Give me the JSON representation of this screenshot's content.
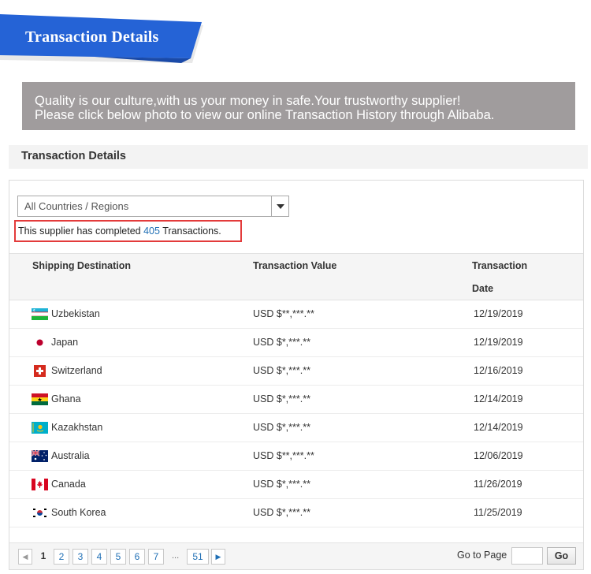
{
  "banner": {
    "title": "Transaction Details",
    "color": "#2563d6"
  },
  "notice": {
    "line1": "Quality is our culture,with us your money in safe.Your trustworthy supplier!",
    "line2": "Please click below photo to view our online Transaction History through Alibaba."
  },
  "section_title": "Transaction Details",
  "filter": {
    "selected": "All Countries / Regions"
  },
  "summary": {
    "prefix": "This supplier has completed ",
    "count": "405",
    "suffix": " Transactions."
  },
  "table": {
    "headers": {
      "destination": "Shipping Destination",
      "value": "Transaction Value",
      "date_line1": "Transaction",
      "date_line2": "Date"
    },
    "rows": [
      {
        "country": "Uzbekistan",
        "flag": "uzbekistan-flag-icon",
        "value": "USD $**,***.**",
        "date": "12/19/2019"
      },
      {
        "country": "Japan",
        "flag": "japan-flag-icon",
        "value": "USD $*,***.**",
        "date": "12/19/2019"
      },
      {
        "country": "Switzerland",
        "flag": "switzerland-flag-icon",
        "value": "USD $*,***.**",
        "date": "12/16/2019"
      },
      {
        "country": "Ghana",
        "flag": "ghana-flag-icon",
        "value": "USD $*,***.**",
        "date": "12/14/2019"
      },
      {
        "country": "Kazakhstan",
        "flag": "kazakhstan-flag-icon",
        "value": "USD $*,***.**",
        "date": "12/14/2019"
      },
      {
        "country": "Australia",
        "flag": "australia-flag-icon",
        "value": "USD $**,***.**",
        "date": "12/06/2019"
      },
      {
        "country": "Canada",
        "flag": "canada-flag-icon",
        "value": "USD $*,***.**",
        "date": "11/26/2019"
      },
      {
        "country": "South Korea",
        "flag": "south-korea-flag-icon",
        "value": "USD $*,***.**",
        "date": "11/25/2019"
      }
    ]
  },
  "pagination": {
    "prev": "◀",
    "next": "▶",
    "pages": [
      "1",
      "2",
      "3",
      "4",
      "5",
      "6",
      "7"
    ],
    "current": "1",
    "ellipsis": "...",
    "last": "51",
    "goto_label": "Go to Page",
    "goto_button": "Go"
  },
  "colors": {
    "highlight_border": "#e33b3b",
    "link": "#1f6fb5",
    "notice_bg": "#a09c9d"
  }
}
